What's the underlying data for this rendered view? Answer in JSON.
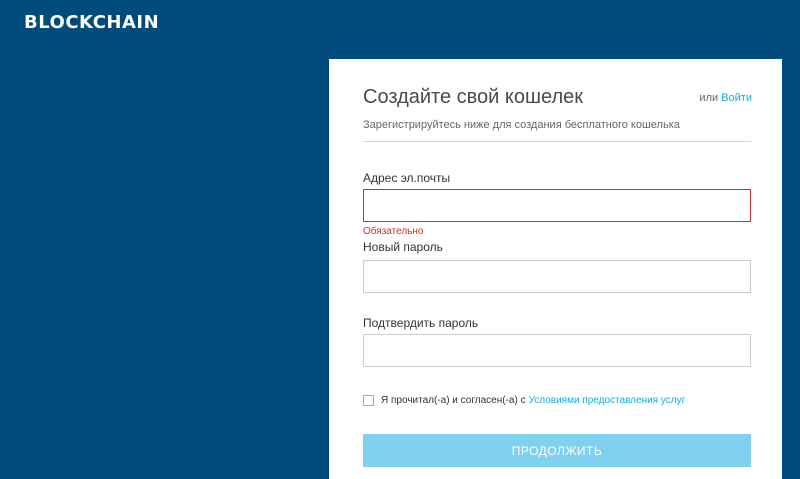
{
  "header": {
    "logo_text": "BLOCKCHAIN"
  },
  "form": {
    "title": "Создайте свой кошелек",
    "login_prefix": "или",
    "login_link": "Войти",
    "subtitle": "Зарегистрируйтесь ниже для создания бесплатного кошелька",
    "email_label": "Адрес эл.почты",
    "email_value": "",
    "email_error": "Обязательно",
    "password_label": "Новый пароль",
    "password_value": "",
    "confirm_label": "Подтвердить пароль",
    "confirm_value": "",
    "terms_text": "Я прочитал(-а) и согласен(-а) с",
    "terms_link": "Условиями предоставления услуг",
    "terms_checked": false,
    "continue_label": "ПРОДОЛЖИТЬ"
  },
  "colors": {
    "background": "#004a7c",
    "accent": "#10ade4",
    "error": "#c9302c",
    "button_disabled": "#7fd1ef"
  }
}
